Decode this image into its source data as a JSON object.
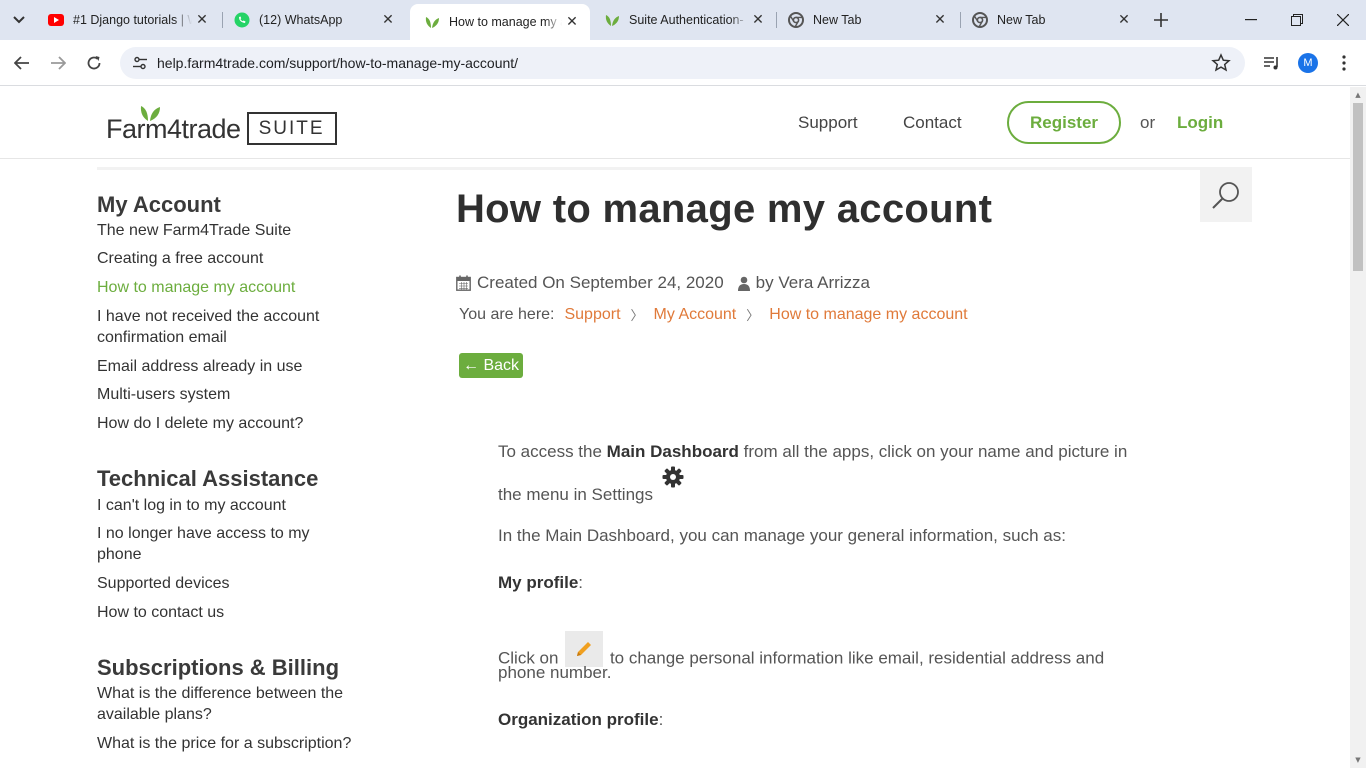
{
  "browser": {
    "tabs": [
      {
        "title": "#1 Django tutorials | W",
        "icon": "youtube-icon"
      },
      {
        "title": "(12) WhatsApp",
        "icon": "whatsapp-icon"
      },
      {
        "title": "How to manage my a",
        "icon": "farm4trade-leaf-icon",
        "active": true
      },
      {
        "title": "Suite Authentication-",
        "icon": "farm4trade-leaf-icon"
      },
      {
        "title": "New Tab",
        "icon": "chrome-icon"
      },
      {
        "title": "New Tab",
        "icon": "chrome-icon"
      }
    ],
    "url": "help.farm4trade.com/support/how-to-manage-my-account/",
    "profile_initial": "M"
  },
  "header": {
    "logo_brand": "Farm4trade",
    "logo_suite": "SUITE",
    "nav": [
      "Support",
      "Contact"
    ],
    "register": "Register",
    "or": "or",
    "login": "Login"
  },
  "sidebar": {
    "sections": [
      {
        "heading": "My Account",
        "items": [
          "The new Farm4Trade Suite",
          "Creating a free account",
          "How to manage my account",
          "I have not received the account confirmation email",
          "Email address already in use",
          "Multi-users system",
          "How do I delete my account?"
        ]
      },
      {
        "heading": "Technical Assistance",
        "items": [
          "I can't log in to my account",
          "I no longer have access to my phone",
          "Supported devices",
          "How to contact us"
        ]
      },
      {
        "heading": "Subscriptions & Billing",
        "items": [
          "What is the difference between the available plans?",
          "What is the price for a subscription?"
        ]
      }
    ]
  },
  "article": {
    "title": "How to manage my account",
    "created": "Created On September 24, 2020",
    "author": "by Vera Arrizza",
    "breadcrumb_label": "You are here:",
    "breadcrumbs": [
      "Support",
      "My Account",
      "How to manage my account"
    ],
    "back": "← Back",
    "p1_a": "To access the ",
    "p1_b": "Main Dashboard",
    "p1_c": " from all the apps, click on your name and picture in",
    "p1_d": "the menu in Settings",
    "p2": "In the Main Dashboard, you can manage your general information, such as:",
    "h_profile": "My profile",
    "colon": ":",
    "p3_a": "Click on",
    "p3_b": "to change personal information like email, residential address and",
    "p3_c": "phone number.",
    "h_org": "Organization profile"
  },
  "colors": {
    "accent_green": "#6cad3e",
    "breadcrumb_orange": "#e07a3a"
  }
}
